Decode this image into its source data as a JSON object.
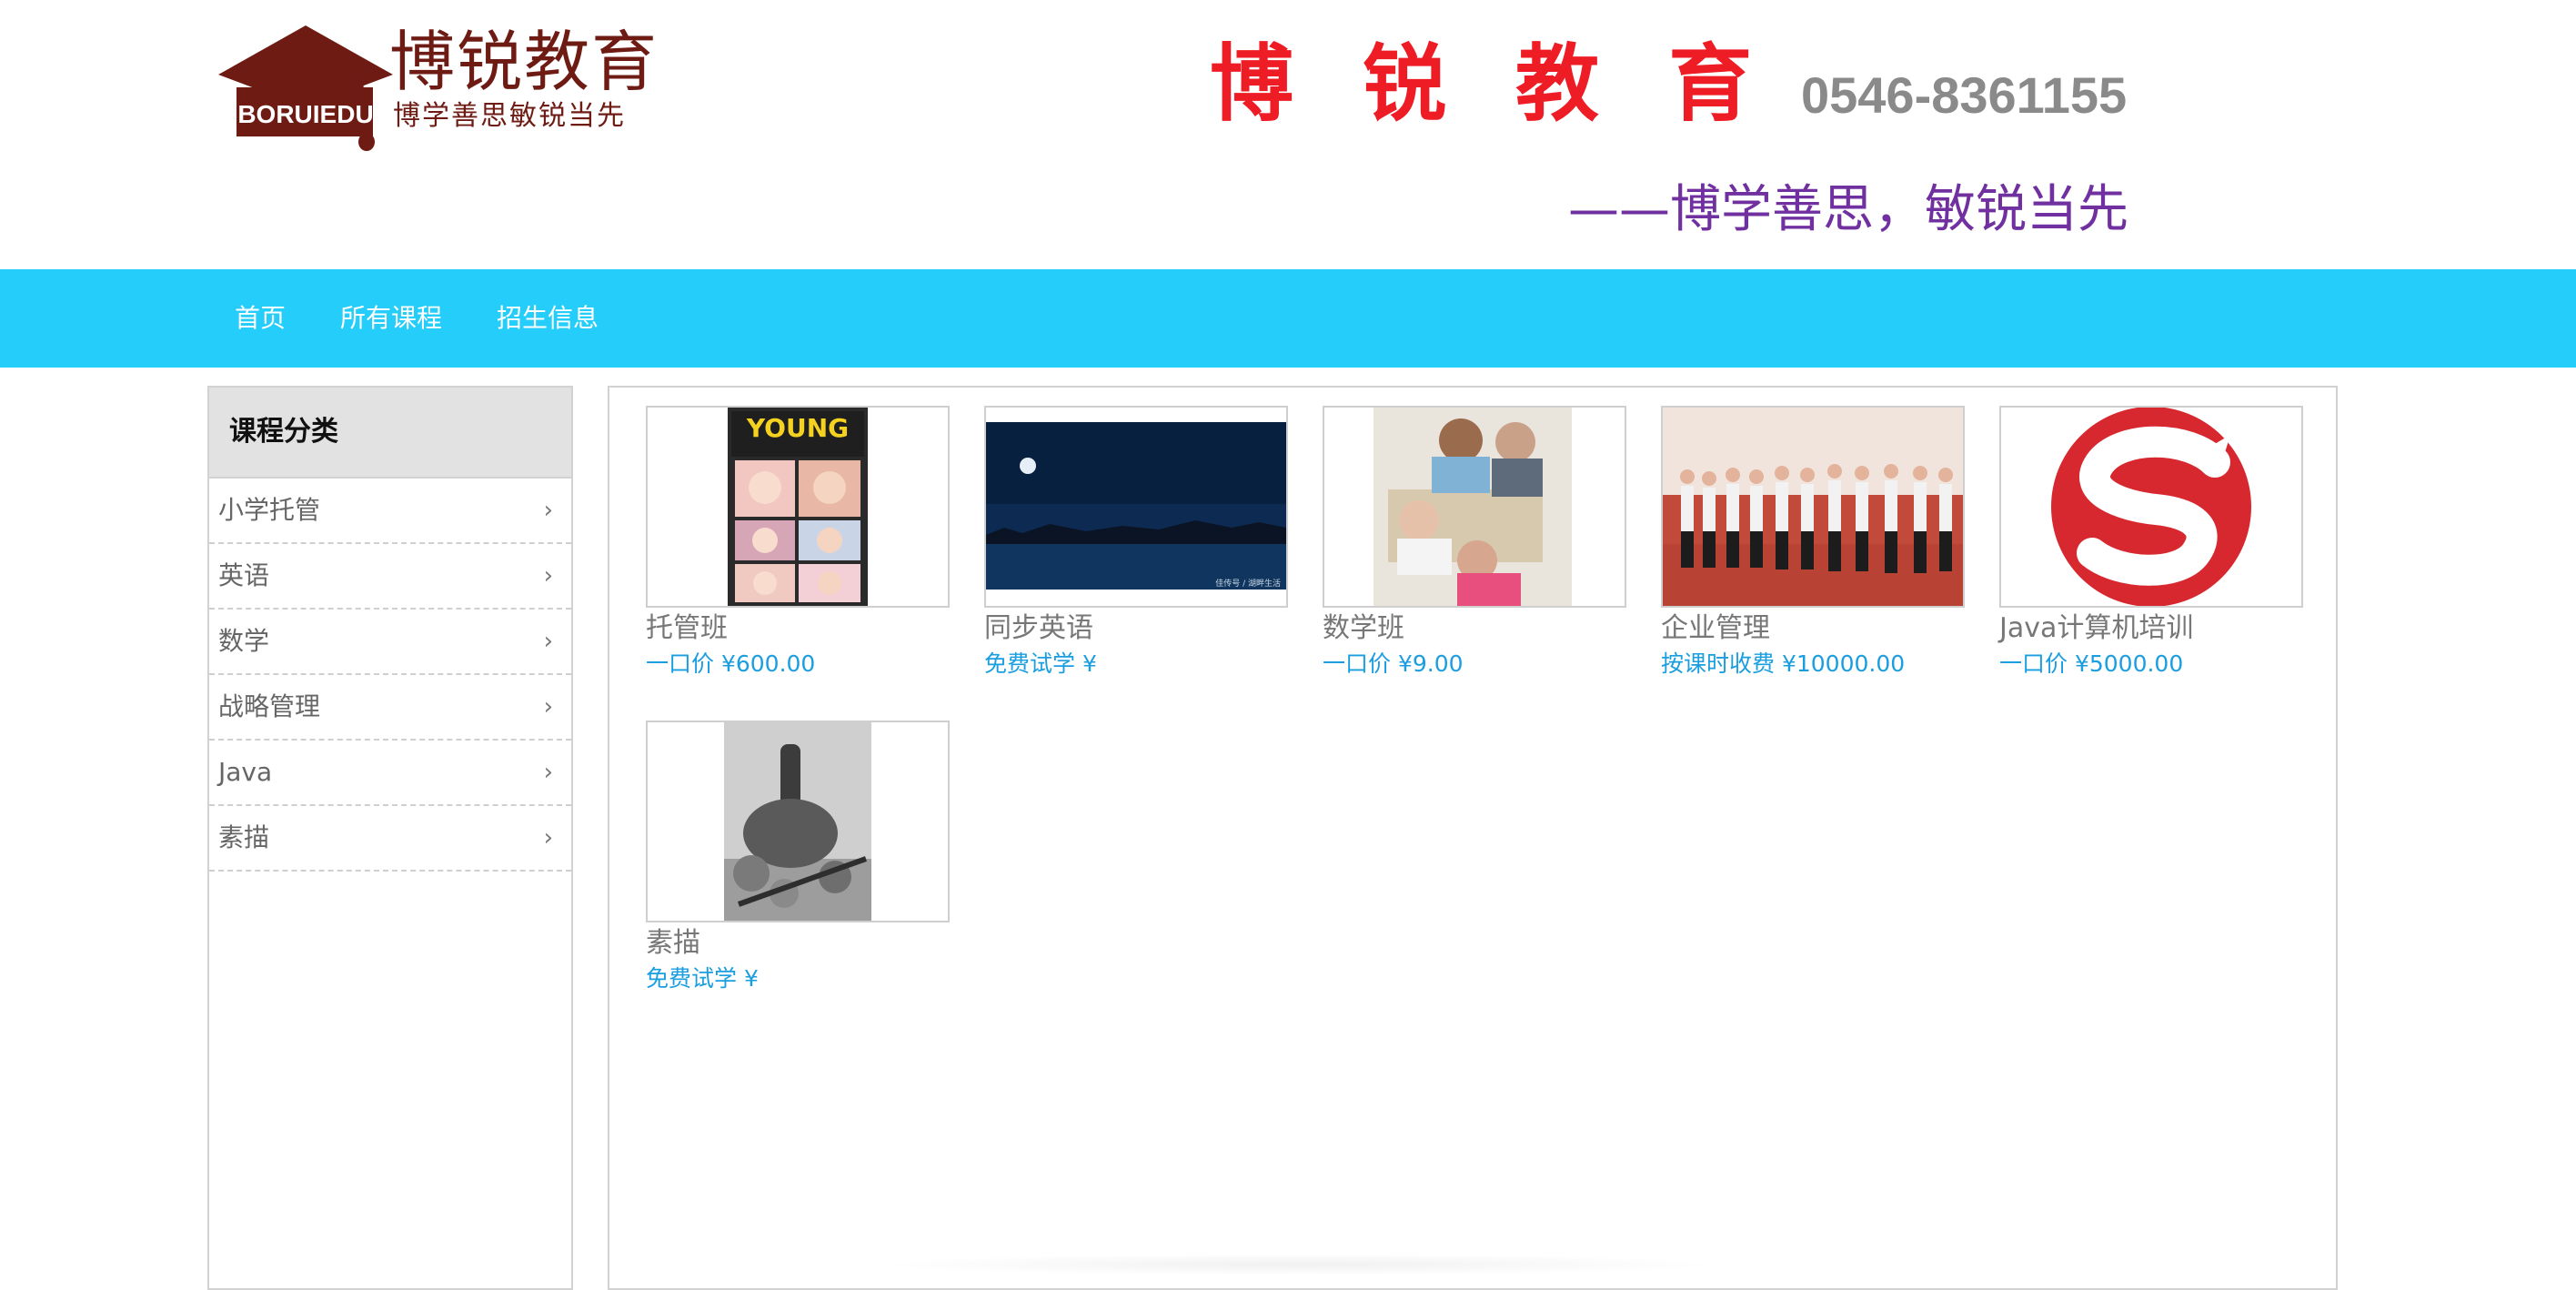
{
  "header": {
    "logo_text": "BORUIEDU",
    "logo_name": "博锐教育",
    "logo_slogan": "博学善思敏锐当先",
    "site_title": "博 锐 教 育",
    "phone": "0546-8361155",
    "motto": "——博学善思，敏锐当先"
  },
  "nav": {
    "items": [
      {
        "label": "首页"
      },
      {
        "label": "所有课程"
      },
      {
        "label": "招生信息"
      }
    ]
  },
  "sidebar": {
    "title": "课程分类",
    "items": [
      {
        "label": "小学托管"
      },
      {
        "label": "英语"
      },
      {
        "label": "数学"
      },
      {
        "label": "战略管理"
      },
      {
        "label": "Java"
      },
      {
        "label": "素描"
      }
    ],
    "arrow_icon": "chevron-right-icon"
  },
  "courses": [
    {
      "name": "托管班",
      "price": "一口价 ¥600.00",
      "image": "children-collage"
    },
    {
      "name": "同步英语",
      "price": "免费试学 ¥",
      "image": "night-lake",
      "image_caption": "佳传号 / 湖畔生活"
    },
    {
      "name": "数学班",
      "price": "一口价 ¥9.00",
      "image": "students-studying"
    },
    {
      "name": "企业管理",
      "price": "按课时收费 ¥10000.00",
      "image": "business-lineup"
    },
    {
      "name": "Java计算机培训",
      "price": "一口价 ¥5000.00",
      "image": "red-s-logo"
    },
    {
      "name": "素描",
      "price": "免费试学 ¥",
      "image": "still-life-sketch"
    }
  ],
  "colors": {
    "nav_bg": "#24cdfa",
    "title_red": "#ee1c24",
    "motto_purple": "#7030a0",
    "price_blue": "#1a9ee0",
    "logo_brown": "#6e1b14"
  }
}
